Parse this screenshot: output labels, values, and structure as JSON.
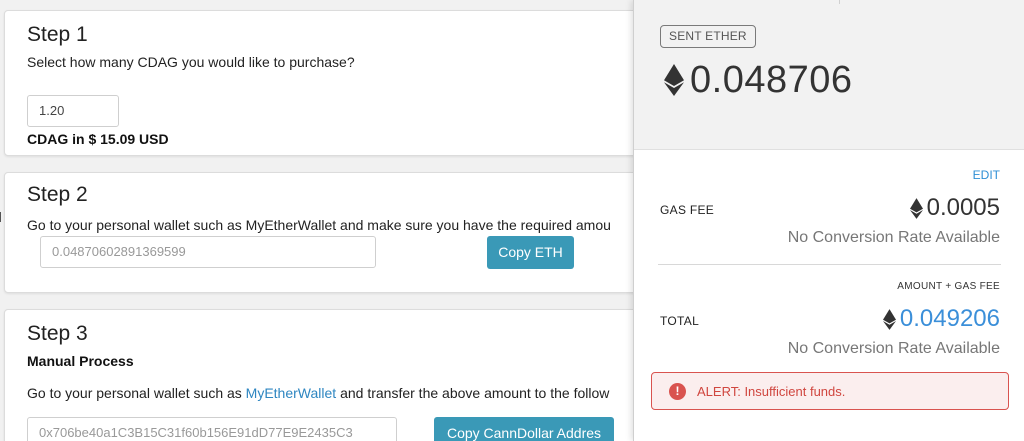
{
  "step1": {
    "title": "Step 1",
    "prompt": "Select how many CDAG you would like to purchase?",
    "quantity_value": "1.20",
    "price_text": "CDAG in $ 15.09 USD"
  },
  "step2": {
    "title": "Step 2",
    "instruction": "Go to your personal wallet such as MyEtherWallet and make sure you have the required amou",
    "eth_amount_value": "0.04870602891369599",
    "copy_button": "Copy ETH"
  },
  "step3": {
    "title": "Step 3",
    "subtitle": "Manual Process",
    "instruction_before": "Go to your personal wallet such as ",
    "instruction_link": "MyEtherWallet",
    "instruction_after": " and transfer the above amount to the follow",
    "address_value": "0x706be40a1C3B15C31f60b156E91dD77E9E2435C3",
    "copy_button": "Copy CannDollar Addres"
  },
  "wallet": {
    "sent_label": "SENT ETHER",
    "sent_amount": "0.048706",
    "edit_label": "EDIT",
    "gas_label": "GAS FEE",
    "gas_amount": "0.0005",
    "gas_conversion": "No Conversion Rate Available",
    "amount_gas_label": "AMOUNT + GAS FEE",
    "total_label": "TOTAL",
    "total_amount": "0.049206",
    "total_conversion": "No Conversion Rate Available",
    "alert_icon": "exclamation-icon",
    "alert_text": "ALERT: Insufficient funds.",
    "colors": {
      "accent": "#3b8fd9",
      "alert": "#d9534f",
      "copy_button": "#3a99b7"
    }
  }
}
